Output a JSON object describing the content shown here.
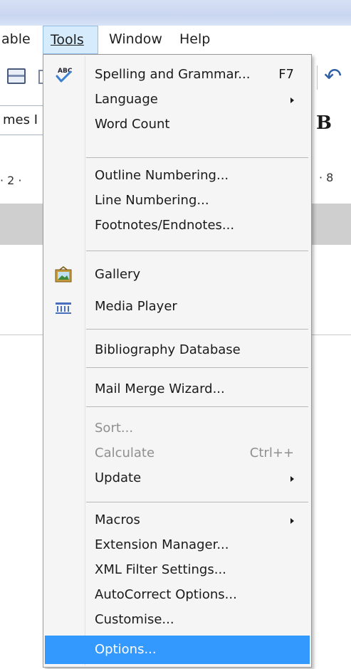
{
  "menubar": {
    "items": [
      {
        "label": "able",
        "active": false
      },
      {
        "label": "Tools",
        "active": true
      },
      {
        "label": "Window",
        "active": false
      },
      {
        "label": "Help",
        "active": false
      }
    ]
  },
  "background": {
    "font_name_fragment": "mes I",
    "ruler_left": "· 2 ·",
    "ruler_right": "· 8",
    "bold_label": "B"
  },
  "tools_menu": {
    "items": [
      {
        "label": "Spelling and Grammar...",
        "shortcut": "F7",
        "icon": "spelling-abc-check-icon"
      },
      {
        "label": "Language",
        "submenu": true
      },
      {
        "label": "Word Count"
      },
      {
        "label": "Outline Numbering..."
      },
      {
        "label": "Line Numbering..."
      },
      {
        "label": "Footnotes/Endnotes..."
      },
      {
        "label": "Gallery",
        "icon": "gallery-picture-icon"
      },
      {
        "label": "Media Player",
        "icon": "media-player-icon"
      },
      {
        "label": "Bibliography Database"
      },
      {
        "label": "Mail Merge Wizard..."
      },
      {
        "label": "Sort...",
        "disabled": true
      },
      {
        "label": "Calculate",
        "shortcut": "Ctrl++",
        "disabled": true
      },
      {
        "label": "Update",
        "submenu": true
      },
      {
        "label": "Macros",
        "submenu": true
      },
      {
        "label": "Extension Manager..."
      },
      {
        "label": "XML Filter Settings..."
      },
      {
        "label": "AutoCorrect Options..."
      },
      {
        "label": "Customise..."
      },
      {
        "label": "Options...",
        "highlighted": true
      }
    ]
  },
  "colors": {
    "highlight": "#3399ff",
    "menu_bg": "#f5f5f5",
    "disabled_text": "#8f8f8f",
    "active_menu_bg": "#d6ebfb"
  }
}
